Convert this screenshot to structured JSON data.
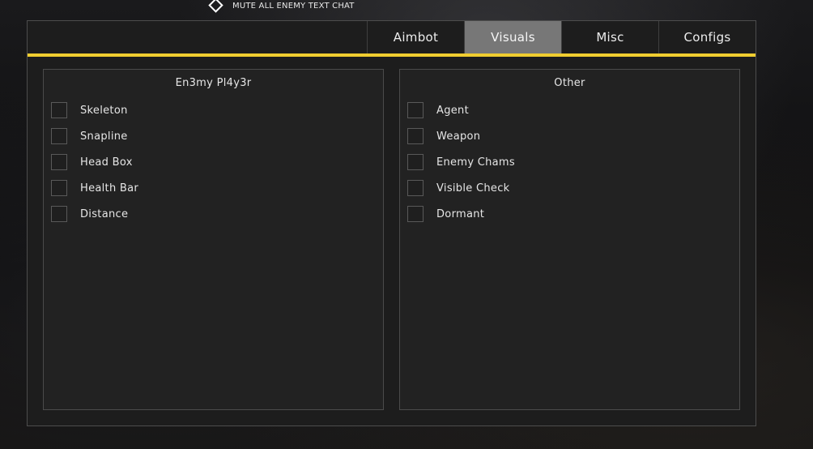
{
  "overlay": {
    "mute_hint": "MUTE ALL ENEMY TEXT CHAT"
  },
  "tabs": [
    {
      "label": "Aimbot",
      "active": false
    },
    {
      "label": "Visuals",
      "active": true
    },
    {
      "label": "Misc",
      "active": false
    },
    {
      "label": "Configs",
      "active": false
    }
  ],
  "colors": {
    "accent": "#f0cd30",
    "active_tab": "#777777",
    "panel_bg": "#222222",
    "menu_bg": "#1d1d1d"
  },
  "panels": {
    "enemy_player": {
      "title": "En3my Pl4y3r",
      "options": [
        {
          "label": "Skeleton",
          "checked": false
        },
        {
          "label": "Snapline",
          "checked": false
        },
        {
          "label": "Head Box",
          "checked": false
        },
        {
          "label": "Health Bar",
          "checked": false
        },
        {
          "label": "Distance",
          "checked": false
        }
      ]
    },
    "other": {
      "title": "Other",
      "options": [
        {
          "label": "Agent",
          "checked": false
        },
        {
          "label": "Weapon",
          "checked": false
        },
        {
          "label": "Enemy Chams",
          "checked": false
        },
        {
          "label": "Visible Check",
          "checked": false
        },
        {
          "label": "Dormant",
          "checked": false
        }
      ]
    }
  }
}
